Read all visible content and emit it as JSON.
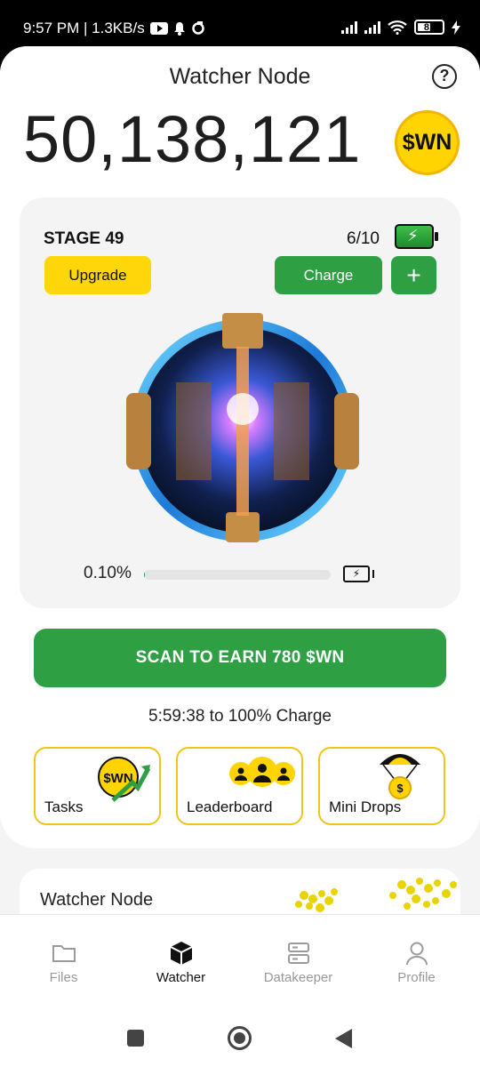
{
  "status_bar": {
    "time_speed": "9:57 PM | 1.3KB/s",
    "battery": "81"
  },
  "header": {
    "title": "Watcher Node",
    "help_icon": "?"
  },
  "balance": {
    "amount": "50,138,121",
    "token_badge": "$WN"
  },
  "stage": {
    "label": "STAGE 49",
    "charges": "6/10",
    "upgrade_label": "Upgrade",
    "charge_label": "Charge",
    "plus_label": "+",
    "progress_text": "0.10%",
    "progress_value": 0.001
  },
  "scan": {
    "button_label": "SCAN TO EARN 780 $WN",
    "timer_text": "5:59:38 to 100% Charge"
  },
  "tiles": [
    {
      "label": "Tasks",
      "badge": "$WN"
    },
    {
      "label": "Leaderboard"
    },
    {
      "label": "Mini Drops",
      "badge": "$"
    }
  ],
  "bottom_card": {
    "title": "Watcher Node"
  },
  "nav": [
    {
      "label": "Files",
      "icon": "folder-icon",
      "active": false
    },
    {
      "label": "Watcher",
      "icon": "cube-icon",
      "active": true
    },
    {
      "label": "Datakeeper",
      "icon": "server-icon",
      "active": false
    },
    {
      "label": "Profile",
      "icon": "user-icon",
      "active": false
    }
  ],
  "colors": {
    "accent_green": "#2ea043",
    "accent_yellow": "#ffd60a"
  }
}
